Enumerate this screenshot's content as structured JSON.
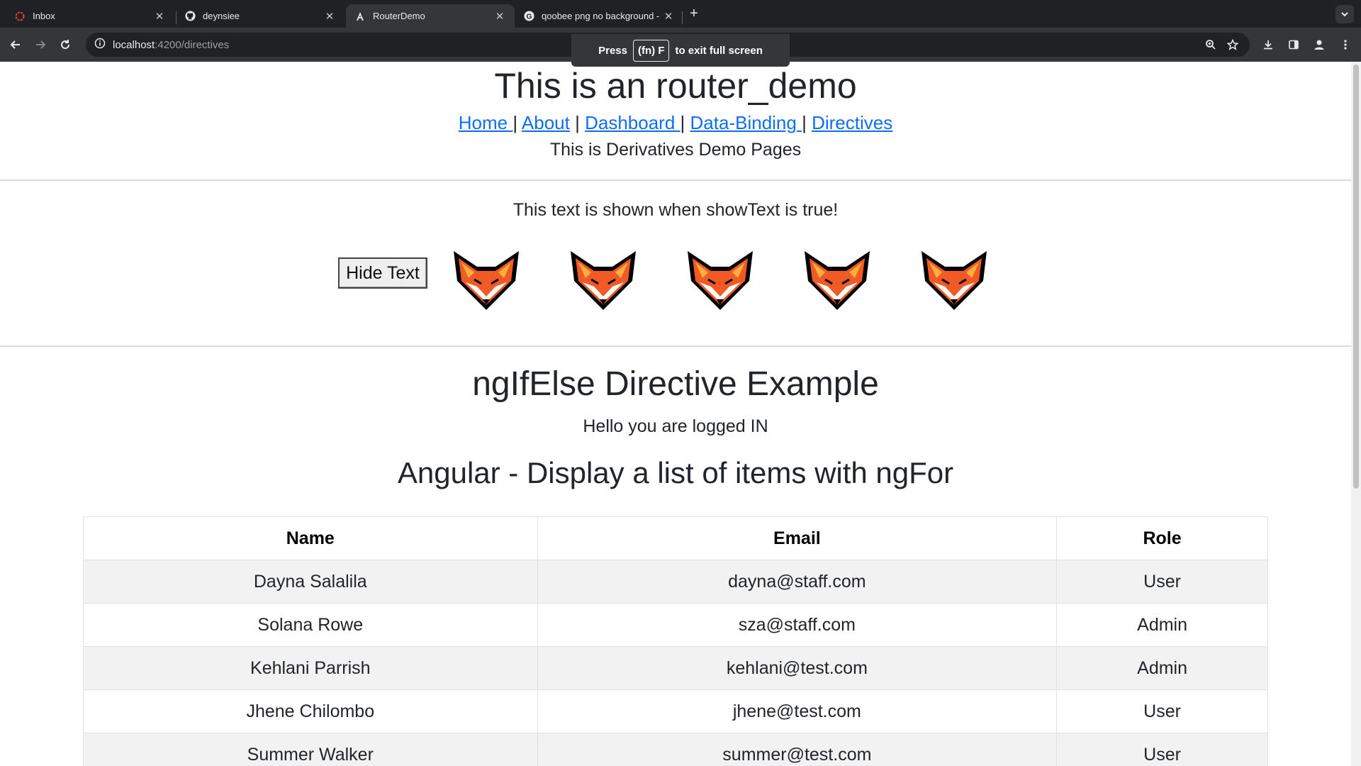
{
  "browser": {
    "tabs": [
      {
        "title": "Inbox",
        "icon": "opera-icon"
      },
      {
        "title": "deynsiee",
        "icon": "github-icon"
      },
      {
        "title": "RouterDemo",
        "icon": "angular-icon"
      },
      {
        "title": "qoobee png no background -",
        "icon": "google-icon"
      }
    ],
    "url_host": "localhost",
    "url_path": ":4200/directives",
    "fullscreen_toast": {
      "before": "Press",
      "key": "(fn) F",
      "after": "to exit full screen"
    }
  },
  "page": {
    "title": "This is an router_demo",
    "nav": [
      {
        "label": "Home "
      },
      {
        "label": "About"
      },
      {
        "label": "Dashboard "
      },
      {
        "label": "Data-Binding "
      },
      {
        "label": "Directives"
      }
    ],
    "nav_separator": "|",
    "subtitle": "This is Derivatives Demo Pages",
    "show_text": "This text is shown when showText is true!",
    "hide_button": "Hide Text",
    "ngifelse_heading": "ngIfElse Directive Example",
    "logged_in": "Hello you are logged IN",
    "ngfor_heading": "Angular - Display a list of items with ngFor",
    "table": {
      "headers": [
        "Name",
        "Email",
        "Role"
      ],
      "rows": [
        [
          "Dayna Salalila",
          "dayna@staff.com",
          "User"
        ],
        [
          "Solana Rowe",
          "sza@staff.com",
          "Admin"
        ],
        [
          "Kehlani Parrish",
          "kehlani@test.com",
          "Admin"
        ],
        [
          "Jhene Chilombo",
          "jhene@test.com",
          "User"
        ],
        [
          "Summer Walker",
          "summer@test.com",
          "User"
        ]
      ]
    },
    "fox_count": 5
  },
  "colors": {
    "link": "#0d6efd",
    "fox_orange": "#f15a24",
    "chrome_dark": "#202124",
    "chrome_toolbar": "#35363a"
  }
}
